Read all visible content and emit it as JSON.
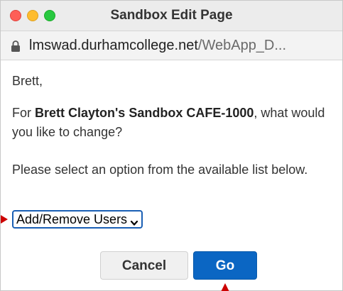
{
  "window": {
    "title": "Sandbox Edit Page"
  },
  "urlbar": {
    "domain": "lmswad.durhamcollege.net",
    "path": "/WebApp_D..."
  },
  "content": {
    "greeting": "Brett,",
    "question_prefix": "For ",
    "question_bold": "Brett Clayton's Sandbox CAFE-1000",
    "question_suffix": ", what would you like to change?",
    "instruction": "Please select an option from the available list below."
  },
  "select": {
    "selected_value": "Add/Remove Users"
  },
  "buttons": {
    "cancel_label": "Cancel",
    "go_label": "Go"
  },
  "colors": {
    "accent": "#0b66c3",
    "annotation": "#cc0000"
  },
  "icons": {
    "lock": "lock-icon",
    "select_chevron": "chevron-down-icon"
  }
}
